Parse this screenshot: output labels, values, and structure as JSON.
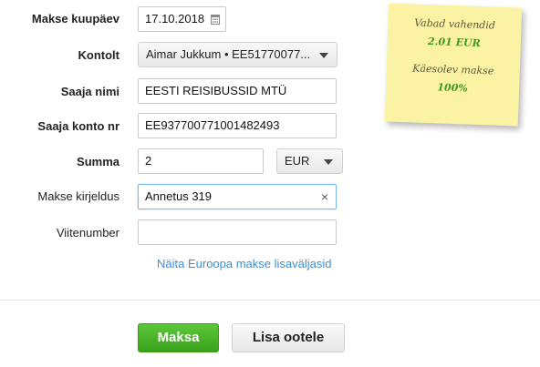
{
  "form": {
    "date": {
      "label": "Makse kuupäev",
      "value": "17.10.2018"
    },
    "account": {
      "label": "Kontolt",
      "value": "Aimar Jukkum • EE51770077..."
    },
    "recipient_name": {
      "label": "Saaja nimi",
      "value": "EESTI REISIBUSSID MTÜ"
    },
    "recipient_account": {
      "label": "Saaja konto nr",
      "value": "EE937700771001482493"
    },
    "amount": {
      "label": "Summa",
      "value": "2",
      "currency": "EUR"
    },
    "description": {
      "label": "Makse kirjeldus",
      "value": "Annetus 319",
      "clear_glyph": "×"
    },
    "reference": {
      "label": "Viitenumber",
      "value": ""
    },
    "europe_link": "Näita Euroopa makse lisaväljasid"
  },
  "sticky_note": {
    "available_label": "Vabad vahendid",
    "available_value": "2.01 EUR",
    "current_payment_label": "Käesolev makse",
    "current_payment_value": "100%"
  },
  "actions": {
    "pay_label": "Maksa",
    "pending_label": "Lisa ootele"
  },
  "colors": {
    "accent_green": "#3aa11b",
    "link_blue": "#3a8fd6",
    "note_yellow": "#fbf2a4"
  }
}
